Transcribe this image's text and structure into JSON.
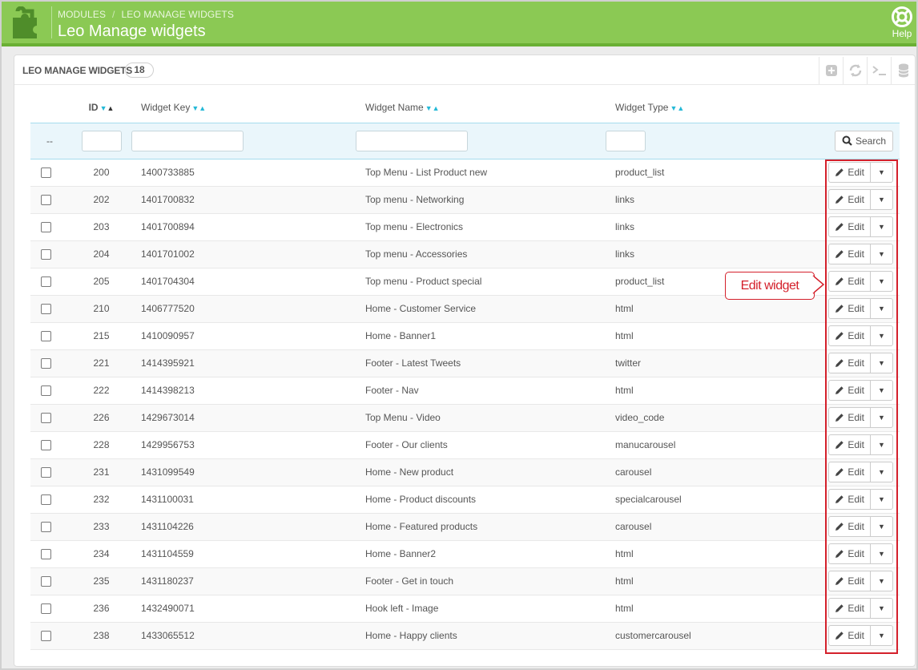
{
  "header": {
    "breadcrumb": [
      "MODULES",
      "LEO MANAGE WIDGETS"
    ],
    "title": "Leo Manage widgets",
    "help_label": "Help"
  },
  "panel": {
    "title": "LEO MANAGE WIDGETS",
    "count": "18",
    "toolbar": [
      "add-new-icon",
      "refresh-icon",
      "sql-query-icon",
      "export-database-icon"
    ]
  },
  "table": {
    "columns": {
      "id": "ID",
      "key": "Widget Key",
      "name": "Widget Name",
      "type": "Widget Type"
    },
    "filter": {
      "checkbox_col": "--",
      "search_label": "Search"
    },
    "edit_label": "Edit",
    "rows": [
      {
        "id": "200",
        "key": "1400733885",
        "name": "Top Menu - List Product new",
        "type": "product_list"
      },
      {
        "id": "202",
        "key": "1401700832",
        "name": "Top menu - Networking",
        "type": "links"
      },
      {
        "id": "203",
        "key": "1401700894",
        "name": "Top menu - Electronics",
        "type": "links"
      },
      {
        "id": "204",
        "key": "1401701002",
        "name": "Top menu - Accessories",
        "type": "links"
      },
      {
        "id": "205",
        "key": "1401704304",
        "name": "Top menu - Product special",
        "type": "product_list"
      },
      {
        "id": "210",
        "key": "1406777520",
        "name": "Home - Customer Service",
        "type": "html"
      },
      {
        "id": "215",
        "key": "1410090957",
        "name": "Home - Banner1",
        "type": "html"
      },
      {
        "id": "221",
        "key": "1414395921",
        "name": "Footer - Latest Tweets",
        "type": "twitter"
      },
      {
        "id": "222",
        "key": "1414398213",
        "name": "Footer - Nav",
        "type": "html"
      },
      {
        "id": "226",
        "key": "1429673014",
        "name": "Top Menu - Video",
        "type": "video_code"
      },
      {
        "id": "228",
        "key": "1429956753",
        "name": "Footer - Our clients",
        "type": "manucarousel"
      },
      {
        "id": "231",
        "key": "1431099549",
        "name": "Home - New product",
        "type": "carousel"
      },
      {
        "id": "232",
        "key": "1431100031",
        "name": "Home - Product discounts",
        "type": "specialcarousel"
      },
      {
        "id": "233",
        "key": "1431104226",
        "name": "Home - Featured products",
        "type": "carousel"
      },
      {
        "id": "234",
        "key": "1431104559",
        "name": "Home - Banner2",
        "type": "html"
      },
      {
        "id": "235",
        "key": "1431180237",
        "name": "Footer - Get in touch",
        "type": "html"
      },
      {
        "id": "236",
        "key": "1432490071",
        "name": "Hook left - Image",
        "type": "html"
      },
      {
        "id": "238",
        "key": "1433065512",
        "name": "Home - Happy clients",
        "type": "customercarousel"
      }
    ]
  },
  "annotation": {
    "callout_text": "Edit widget",
    "color": "#d4202b"
  },
  "colors": {
    "header_bg": "#8bc954",
    "accent": "#25b9d7"
  }
}
